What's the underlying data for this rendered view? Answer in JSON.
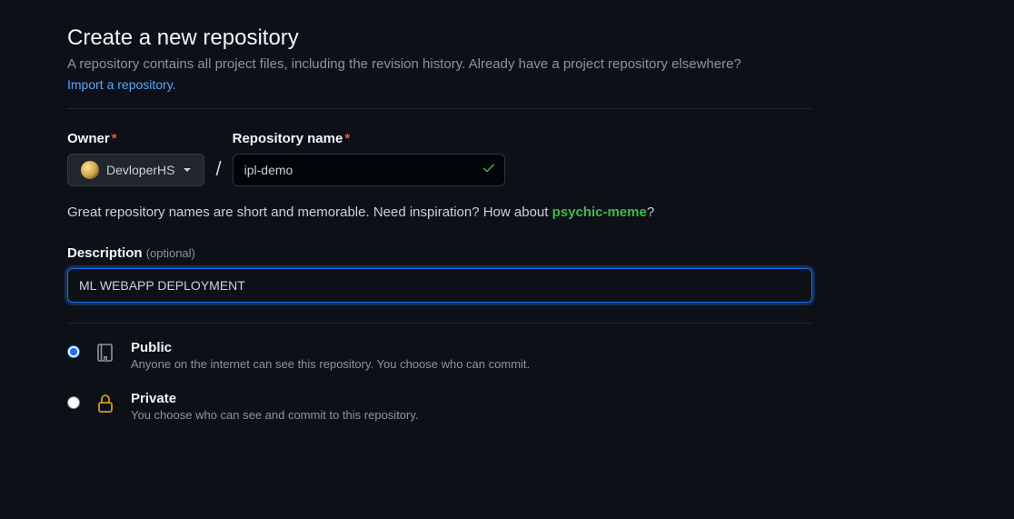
{
  "header": {
    "title": "Create a new repository",
    "subhead": "A repository contains all project files, including the revision history. Already have a project repository elsewhere?",
    "import_link": "Import a repository.",
    "period": ""
  },
  "owner": {
    "label": "Owner",
    "username": "DevloperHS"
  },
  "repo": {
    "label": "Repository name",
    "value": "ipl-demo"
  },
  "note": {
    "prefix": "Great repository names are short and memorable. Need inspiration? How about ",
    "suggestion": "psychic-meme",
    "suffix": "?"
  },
  "description": {
    "label": "Description ",
    "optional": "(optional)",
    "value": "ML WEBAPP DEPLOYMENT"
  },
  "visibility": {
    "public": {
      "title": "Public",
      "hint": "Anyone on the internet can see this repository. You choose who can commit."
    },
    "private": {
      "title": "Private",
      "hint": "You choose who can see and commit to this repository."
    }
  }
}
